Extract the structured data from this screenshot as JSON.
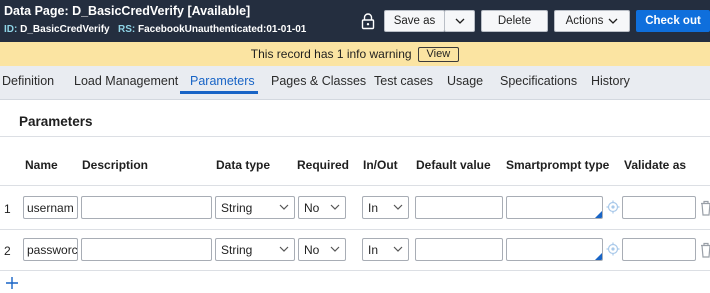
{
  "header": {
    "title": "Data Page: D_BasicCredVerify",
    "status": "[Available]",
    "id_label": "ID:",
    "id_value": "D_BasicCredVerify",
    "rs_label": "RS:",
    "rs_value": "FacebookUnauthenticated:01-01-01",
    "buttons": {
      "save_as": "Save as",
      "delete": "Delete",
      "actions": "Actions",
      "check_out": "Check out"
    },
    "colors": {
      "header_bg": "#242e3f",
      "primary": "#0f6fdc"
    }
  },
  "warning": {
    "text": "This record has 1 info warning",
    "view_label": "View",
    "color": "#fbe4a2"
  },
  "tabs": [
    {
      "label": "Definition"
    },
    {
      "label": "Load Management"
    },
    {
      "label": "Parameters",
      "active": true
    },
    {
      "label": "Pages & Classes"
    },
    {
      "label": "Test cases"
    },
    {
      "label": "Usage"
    },
    {
      "label": "Specifications"
    },
    {
      "label": "History"
    }
  ],
  "section": {
    "title": "Parameters"
  },
  "table": {
    "headers": {
      "name": "Name",
      "description": "Description",
      "data_type": "Data type",
      "required": "Required",
      "in_out": "In/Out",
      "default_value": "Default value",
      "smartprompt_type": "Smartprompt type",
      "validate_as": "Validate as"
    },
    "rows": [
      {
        "num": "1",
        "name": "usernam",
        "description": "",
        "data_type": "String",
        "required": "No",
        "in_out": "In",
        "default_value": "",
        "smartprompt_type": "",
        "validate_as": ""
      },
      {
        "num": "2",
        "name": "passworc",
        "description": "",
        "data_type": "String",
        "required": "No",
        "in_out": "In",
        "default_value": "",
        "smartprompt_type": "",
        "validate_as": ""
      }
    ]
  },
  "icons": [
    "lock-icon",
    "chevron-down-icon",
    "gear-target-icon",
    "trash-icon",
    "add-icon"
  ]
}
